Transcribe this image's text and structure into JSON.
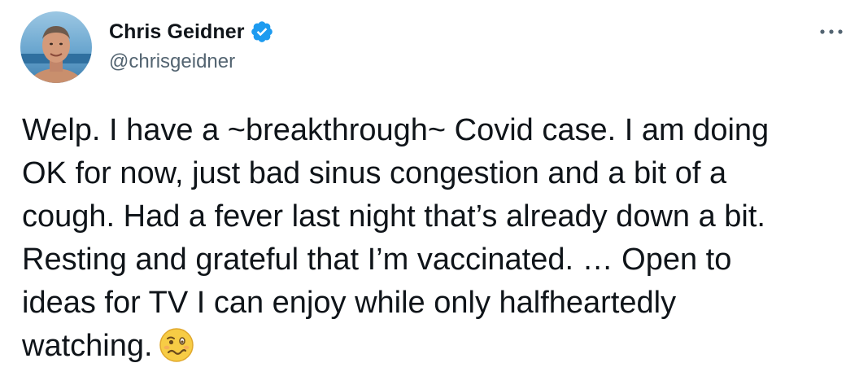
{
  "author": {
    "display_name": "Chris Geidner",
    "handle": "@chrisgeidner",
    "verified": true,
    "avatar_icon": "profile-photo",
    "verified_icon": "verified-badge-icon",
    "verified_color": "#1d9bf0"
  },
  "menu": {
    "icon": "more-options-icon",
    "glyph": "···"
  },
  "tweet": {
    "lines": [
      "Welp. I have a ~breakthrough~ Covid case. I am doing",
      "OK for now, just bad sinus congestion and a bit of a",
      "cough. Had a fever last night that’s already down a bit.",
      "Resting and grateful that I’m vaccinated. … Open to",
      "ideas for TV I can enjoy while only halfheartedly",
      "watching."
    ],
    "emoji_icon": "woozy-face-emoji"
  },
  "colors": {
    "text": "#0f1419",
    "secondary": "#536471",
    "accent": "#1d9bf0"
  }
}
